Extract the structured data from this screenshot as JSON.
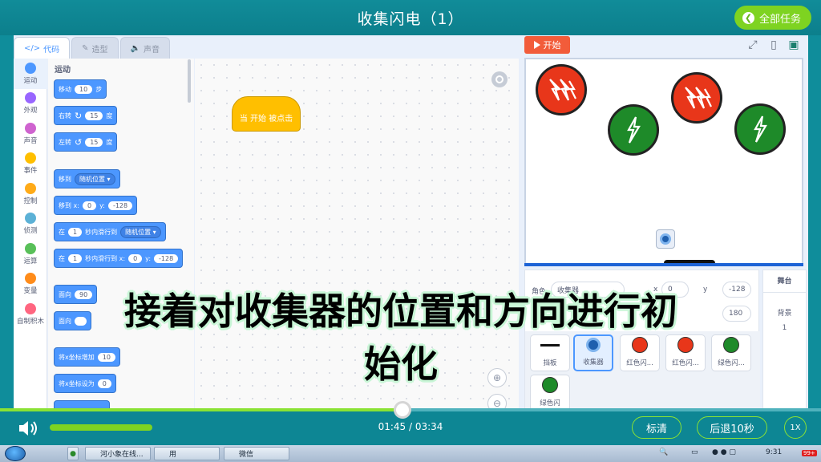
{
  "header": {
    "title": "收集闪电（1）",
    "all_tasks_label": "全部任务"
  },
  "tabs": [
    {
      "label": "代码",
      "icon": "code-icon"
    },
    {
      "label": "造型",
      "icon": "brush-icon"
    },
    {
      "label": "声音",
      "icon": "sound-icon"
    }
  ],
  "categories": [
    {
      "label": "运动",
      "color": "#4c97ff"
    },
    {
      "label": "外观",
      "color": "#9966ff"
    },
    {
      "label": "声音",
      "color": "#cf63cf"
    },
    {
      "label": "事件",
      "color": "#ffbf00"
    },
    {
      "label": "控制",
      "color": "#ffab19"
    },
    {
      "label": "侦测",
      "color": "#5cb1d6"
    },
    {
      "label": "运算",
      "color": "#59c059"
    },
    {
      "label": "变量",
      "color": "#ff8c1a"
    },
    {
      "label": "自制积木",
      "color": "#ff6680"
    }
  ],
  "palette": {
    "heading": "运动",
    "move": {
      "pre": "移动",
      "val": "10",
      "post": "步"
    },
    "turn_right": {
      "pre": "右转",
      "icon": "↻",
      "val": "15",
      "post": "度"
    },
    "turn_left": {
      "pre": "左转",
      "icon": "↺",
      "val": "15",
      "post": "度"
    },
    "goto": {
      "pre": "移到",
      "opt": "随机位置 ▾"
    },
    "goto_xy": {
      "pre": "移到 x:",
      "x": "0",
      "mid": "y:",
      "y": "-128"
    },
    "glide": {
      "pre": "在",
      "val": "1",
      "mid": "秒内滑行到",
      "opt": "随机位置 ▾"
    },
    "glide_xy": {
      "pre": "在",
      "val": "1",
      "mid": "秒内滑行到 x:",
      "x": "0",
      "mid2": "y:",
      "y": "-128"
    },
    "point": {
      "pre": "面向",
      "val": "90"
    },
    "point_to": {
      "pre": "面向"
    },
    "change_x": {
      "pre": "将x坐标增加",
      "val": "10"
    },
    "set_x": {
      "pre": "将x坐标设为",
      "val": "0"
    }
  },
  "script": {
    "hat_label": "当 开始 被点击"
  },
  "stage": {
    "start_label": "开始"
  },
  "sprite_info": {
    "role_label": "角色",
    "role_value": "收集器",
    "x_label": "x",
    "x_value": "0",
    "y_label": "y",
    "y_value": "-128",
    "direction_value": "180"
  },
  "sprites": [
    {
      "label": "挡板",
      "kind": "paddle"
    },
    {
      "label": "收集器",
      "kind": "collector",
      "selected": true
    },
    {
      "label": "红色闪...",
      "kind": "red"
    },
    {
      "label": "红色闪...",
      "kind": "red"
    },
    {
      "label": "绿色闪...",
      "kind": "green"
    },
    {
      "label": "绿色闪",
      "kind": "green"
    }
  ],
  "stage_side": {
    "heading": "舞台",
    "backdrop_label": "背景",
    "backdrop_count": "1"
  },
  "subtitle": {
    "line1": "接着对收集器的位置和方向进行初",
    "line2": "始化"
  },
  "player": {
    "time": "01:45 / 03:34",
    "progress": 0.49,
    "volume": 1.0,
    "btn_quality": "标清",
    "btn_back": "后退10秒",
    "btn_speed": "1X"
  },
  "taskbar": {
    "items": [
      "河小象在线...",
      "用",
      "微信"
    ],
    "clock": "9:31",
    "badge": "99+"
  },
  "colors": {
    "accent": "#4c97ff",
    "header": "#0f8d9b",
    "green": "#7ed321",
    "red_bolt": "#e8361a",
    "green_bolt": "#1e8a29"
  }
}
